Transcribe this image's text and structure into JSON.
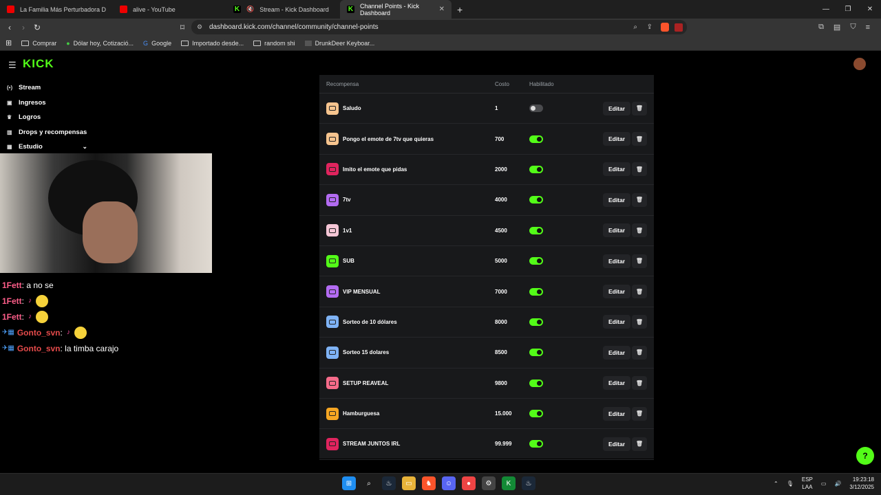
{
  "browser": {
    "tabs": [
      {
        "title": "La Familia Más Perturbadora De TikTo",
        "kind": "yt"
      },
      {
        "title": "alive - YouTube",
        "kind": "yt"
      },
      {
        "title": "Stream - Kick Dashboard",
        "kind": "kick"
      },
      {
        "title": "Channel Points - Kick Dashboard",
        "kind": "kick",
        "active": true
      }
    ],
    "new_tab": "+",
    "url": "dashboard.kick.com/channel/community/channel-points",
    "bookmarks": [
      "Comprar",
      "Dólar hoy, Cotizació...",
      "Google",
      "Importado desde...",
      "random shi",
      "DrunkDeer Keyboar..."
    ],
    "shield_count": "1",
    "alert_count": "1"
  },
  "kick": {
    "logo": "KICK",
    "sidebar": [
      {
        "label": "Stream",
        "icon": "broadcast-icon"
      },
      {
        "label": "Ingresos",
        "icon": "coin-icon"
      },
      {
        "label": "Logros",
        "icon": "trophy-icon"
      },
      {
        "label": "Drops y recompensas",
        "icon": "gift-icon"
      },
      {
        "label": "Estudio",
        "icon": "studio-icon"
      }
    ],
    "chat": [
      {
        "user": "1Fett",
        "text": "a no se"
      },
      {
        "user": "1Fett",
        "text": ""
      },
      {
        "user": "1Fett",
        "text": ""
      },
      {
        "user": "Gonto_svn",
        "text": ""
      },
      {
        "user": "Gonto_svn",
        "text": "la timba carajo"
      }
    ]
  },
  "rewards": {
    "headers": {
      "name": "Recompensa",
      "cost": "Costo",
      "enabled": "Habilitado"
    },
    "edit_label": "Editar",
    "items": [
      {
        "name": "Saludo",
        "cost": "1",
        "enabled": false,
        "color": "#f6c48e"
      },
      {
        "name": "Pongo el emote de 7tv que quieras",
        "cost": "700",
        "enabled": true,
        "color": "#f6c48e"
      },
      {
        "name": "Imito el emote que pidas",
        "cost": "2000",
        "enabled": true,
        "color": "#e0245e"
      },
      {
        "name": "7tv",
        "cost": "4000",
        "enabled": true,
        "color": "#b36bf2"
      },
      {
        "name": "1v1",
        "cost": "4500",
        "enabled": true,
        "color": "#f5c6d6"
      },
      {
        "name": "SUB",
        "cost": "5000",
        "enabled": true,
        "color": "#53fc18"
      },
      {
        "name": "VIP MENSUAL",
        "cost": "7000",
        "enabled": true,
        "color": "#b36bf2"
      },
      {
        "name": "Sorteo de 10 dólares",
        "cost": "8000",
        "enabled": true,
        "color": "#7fb3f5"
      },
      {
        "name": "Sorteo 15 dolares",
        "cost": "8500",
        "enabled": true,
        "color": "#7fb3f5"
      },
      {
        "name": "SETUP REAVEAL",
        "cost": "9800",
        "enabled": true,
        "color": "#f56b8a"
      },
      {
        "name": "Hamburguesa",
        "cost": "15.000",
        "enabled": true,
        "color": "#f5a623"
      },
      {
        "name": "STREAM JUNTOS IRL",
        "cost": "99.999",
        "enabled": true,
        "color": "#e0245e"
      }
    ]
  },
  "taskbar": {
    "lang1": "ESP",
    "lang2": "LAA",
    "time": "19:23:18",
    "date": "3/12/2025"
  }
}
